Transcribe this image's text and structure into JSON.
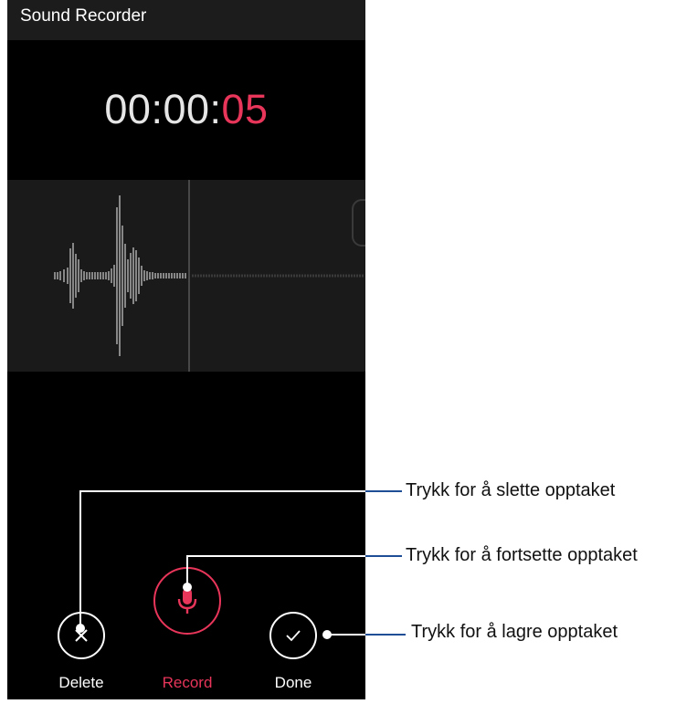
{
  "app": {
    "title": "Sound Recorder"
  },
  "timer": {
    "main": "00:00:",
    "seconds": "05"
  },
  "controls": {
    "delete_label": "Delete",
    "record_label": "Record",
    "done_label": "Done"
  },
  "callouts": {
    "delete": "Trykk for å slette opptaket",
    "record": "Trykk for å fortsette opptaket",
    "done": "Trykk for å lagre opptaket"
  },
  "icons": {
    "delete": "close-icon",
    "record": "microphone-icon",
    "done": "check-icon"
  },
  "colors": {
    "accent": "#e8355a",
    "background": "#000000",
    "appbar": "#1c1c1c",
    "waveform_panel": "#1a1a1a",
    "callout_line": "#1f4e96"
  }
}
